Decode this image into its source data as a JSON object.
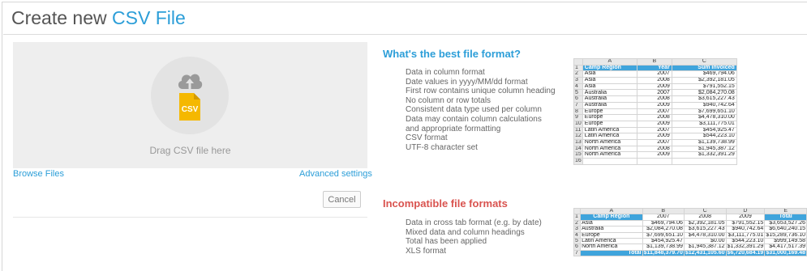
{
  "page": {
    "title_prefix": "Create new",
    "title_accent": "CSV File"
  },
  "upload": {
    "drop_label": "Drag CSV file here",
    "file_icon_text": "CSV",
    "browse_label": "Browse Files",
    "advanced_label": "Advanced settings",
    "cancel_label": "Cancel"
  },
  "best_format": {
    "heading": "What's the best file format?",
    "items": [
      "Data in column format",
      "Date values in yyyy/MM/dd format",
      "First row contains unique column heading",
      "No column or row totals",
      "Consistent data type used per column",
      "Data may contain column calculations",
      "and appropriate formatting",
      "CSV format",
      "UTF-8 character set"
    ]
  },
  "incompatible": {
    "heading": "Incompatible file formats",
    "items": [
      "Data in cross tab format (e.g. by date)",
      "Mixed data and column headings",
      "Total has been applied",
      "XLS format"
    ]
  },
  "sheet1": {
    "col_letters": [
      "A",
      "B",
      "C"
    ],
    "headers": [
      "Camp Region",
      "Year",
      "Sum Invoiced"
    ],
    "rows": [
      [
        "Asia",
        "2007",
        "$469,794.06"
      ],
      [
        "Asia",
        "2008",
        "$2,392,181.05"
      ],
      [
        "Asia",
        "2009",
        "$791,552.15"
      ],
      [
        "Australia",
        "2007",
        "$2,084,270.08"
      ],
      [
        "Australia",
        "2008",
        "$3,615,227.43"
      ],
      [
        "Australia",
        "2009",
        "$940,742.64"
      ],
      [
        "Europe",
        "2007",
        "$7,699,651.10"
      ],
      [
        "Europe",
        "2008",
        "$4,478,310.00"
      ],
      [
        "Europe",
        "2009",
        "$3,111,775.01"
      ],
      [
        "Latin America",
        "2007",
        "$454,925.47"
      ],
      [
        "Latin America",
        "2009",
        "$544,223.10"
      ],
      [
        "North America",
        "2007",
        "$1,139,738.99"
      ],
      [
        "North America",
        "2008",
        "$1,945,387.12"
      ],
      [
        "North America",
        "2009",
        "$1,332,391.29"
      ]
    ],
    "empty_row_number": "16"
  },
  "sheet2": {
    "col_letters": [
      "A",
      "B",
      "C",
      "D",
      "E"
    ],
    "headers": [
      "Camp Region",
      "2007",
      "2008",
      "2009",
      "Total"
    ],
    "rows": [
      [
        "Asia",
        "$469,794.06",
        "$2,392,181.05",
        "$791,552.15",
        "$3,653,527.26"
      ],
      [
        "Australia",
        "$2,084,270.08",
        "$3,615,227.43",
        "$940,742.64",
        "$6,640,240.15"
      ],
      [
        "Europe",
        "$7,699,651.10",
        "$4,478,310.00",
        "$3,111,775.01",
        "$15,289,736.10"
      ],
      [
        "Latin America",
        "$454,925.47",
        "$0.00",
        "$544,223.10",
        "$999,149.58"
      ],
      [
        "North America",
        "$1,139,738.99",
        "$1,945,387.12",
        "$1,332,391.29",
        "$4,417,517.39"
      ]
    ],
    "total_row": [
      "Total",
      "$11,848,379.70",
      "$12,431,105.60",
      "$6,720,684.19",
      "$31,000,169.48"
    ]
  },
  "colors": {
    "accent": "#2c9ed8",
    "danger": "#d9534f",
    "file_icon": "#f5b800",
    "sheet_header": "#3fa4dc"
  }
}
